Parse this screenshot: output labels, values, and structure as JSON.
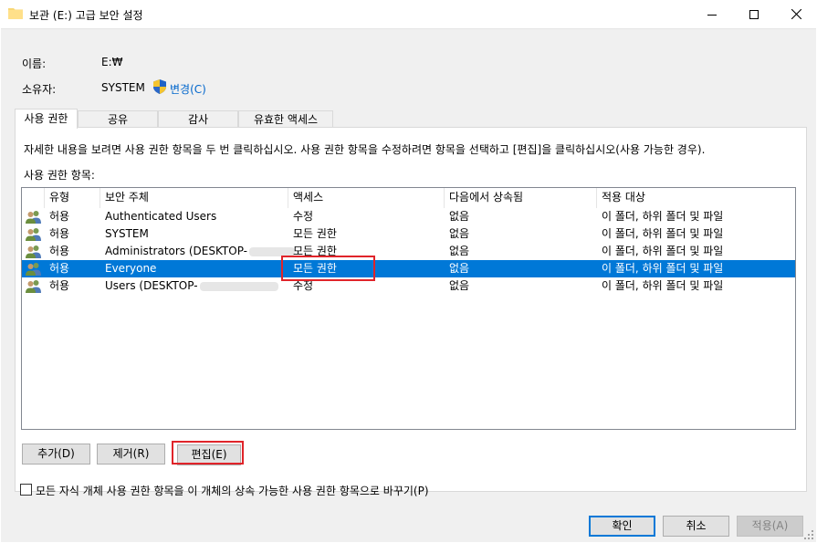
{
  "window": {
    "title": "보관 (E:) 고급 보안 설정"
  },
  "info": {
    "name_label": "이름:",
    "name_value": "E:₩",
    "owner_label": "소유자:",
    "owner_value": "SYSTEM",
    "change_link": "변경(C)"
  },
  "tabs": [
    {
      "label": "사용 권한",
      "active": true
    },
    {
      "label": "공유",
      "active": false
    },
    {
      "label": "감사",
      "active": false
    },
    {
      "label": "유효한 액세스",
      "active": false
    }
  ],
  "panel": {
    "description": "자세한 내용을 보려면 사용 권한 항목을 두 번 클릭하십시오. 사용 권한 항목을 수정하려면 항목을 선택하고 [편집]을 클릭하십시오(사용 가능한 경우).",
    "list_caption": "사용 권한 항목:"
  },
  "table": {
    "columns": [
      "유형",
      "보안 주체",
      "액세스",
      "다음에서 상속됨",
      "적용 대상"
    ],
    "rows": [
      {
        "type": "허용",
        "principal": "Authenticated Users",
        "access": "수정",
        "inherited": "없음",
        "applies": "이 폴더, 하위 폴더 및 파일",
        "selected": false
      },
      {
        "type": "허용",
        "principal": "SYSTEM",
        "access": "모든 권한",
        "inherited": "없음",
        "applies": "이 폴더, 하위 폴더 및 파일",
        "selected": false
      },
      {
        "type": "허용",
        "principal": "Administrators (DESKTOP-",
        "access": "모든 권한",
        "inherited": "없음",
        "applies": "이 폴더, 하위 폴더 및 파일",
        "selected": false
      },
      {
        "type": "허용",
        "principal": "Everyone",
        "access": "모든 권한",
        "inherited": "없음",
        "applies": "이 폴더, 하위 폴더 및 파일",
        "selected": true
      },
      {
        "type": "허용",
        "principal": "Users (DESKTOP-",
        "access": "수정",
        "inherited": "없음",
        "applies": "이 폴더, 하위 폴더 및 파일",
        "selected": false
      }
    ]
  },
  "buttons": {
    "add": "추가(D)",
    "remove": "제거(R)",
    "edit": "편집(E)",
    "ok": "확인",
    "cancel": "취소",
    "apply": "적용(A)"
  },
  "checkbox": {
    "label": "모든 자식 개체 사용 권한 항목을 이 개체의 상속 가능한 사용 권한 항목으로 바꾸기(P)",
    "checked": false
  },
  "colors": {
    "selection": "#0078d7",
    "highlight_box": "#e0242a",
    "link": "#0066cc"
  }
}
